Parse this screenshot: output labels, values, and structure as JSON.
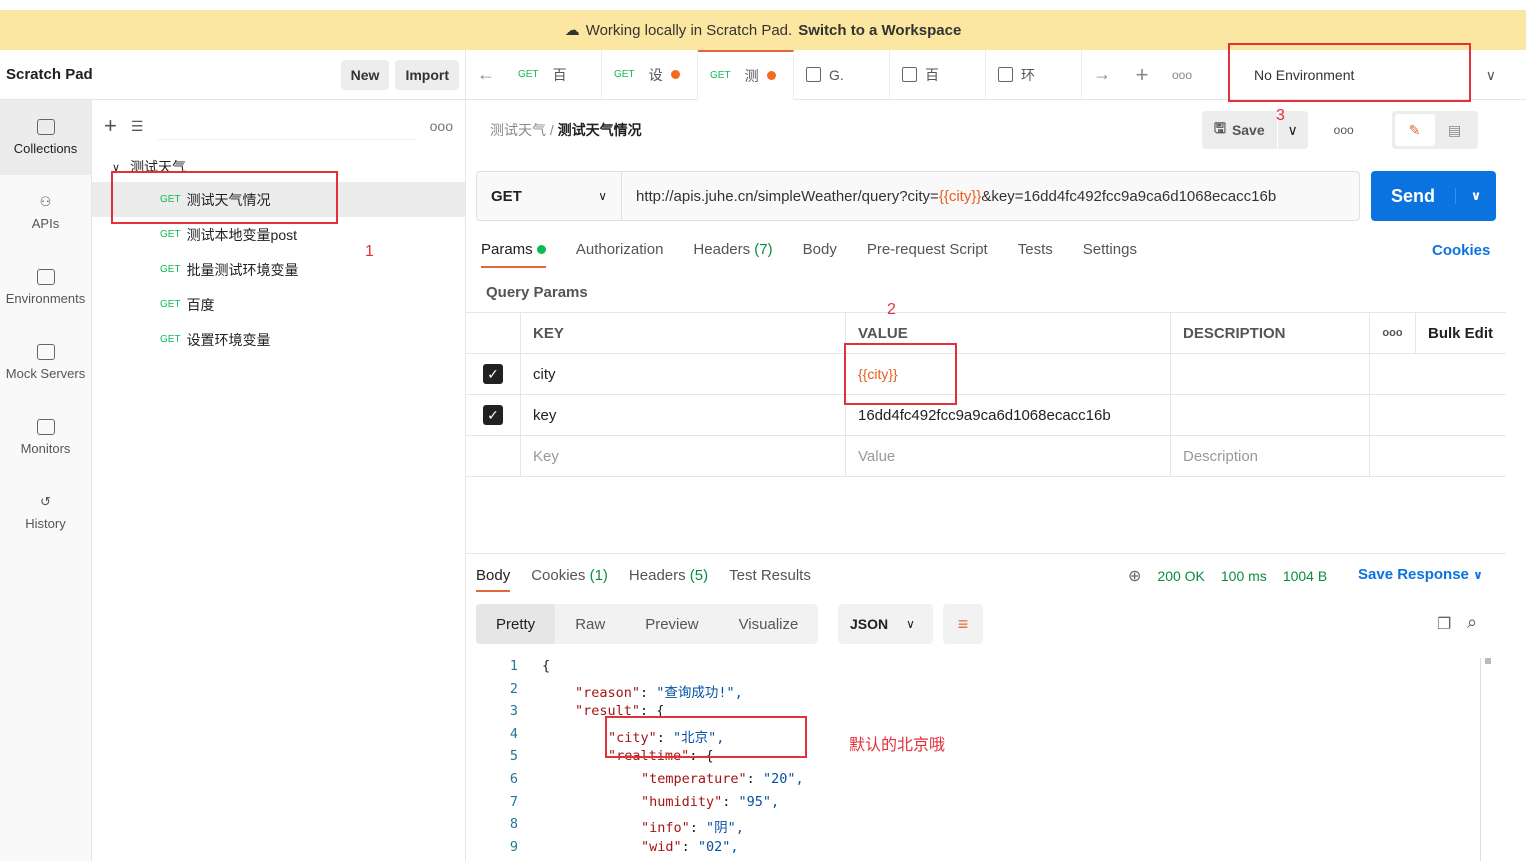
{
  "banner": {
    "text": "Working locally in Scratch Pad.",
    "link": "Switch to a Workspace"
  },
  "sidebar": {
    "title": "Scratch Pad",
    "new_label": "New",
    "import_label": "Import",
    "rail": [
      {
        "label": "Collections",
        "icon": "collections-icon"
      },
      {
        "label": "APIs",
        "icon": "apis-icon"
      },
      {
        "label": "Environments",
        "icon": "environments-icon"
      },
      {
        "label": "Mock Servers",
        "icon": "mock-servers-icon"
      },
      {
        "label": "Monitors",
        "icon": "monitors-icon"
      },
      {
        "label": "History",
        "icon": "history-icon"
      }
    ],
    "collection": "测试天气",
    "items": [
      {
        "method": "GET",
        "name": "测试天气情况"
      },
      {
        "method": "GET",
        "name": "测试本地变量post"
      },
      {
        "method": "GET",
        "name": "批量测试环境变量"
      },
      {
        "method": "GET",
        "name": "百度"
      },
      {
        "method": "GET",
        "name": "设置环境变量"
      }
    ]
  },
  "tabs": [
    {
      "method": "GET",
      "name": "百"
    },
    {
      "method": "GET",
      "name": "设",
      "dirty": true
    },
    {
      "method": "GET",
      "name": "测",
      "dirty": true,
      "active": true
    },
    {
      "name": "G."
    },
    {
      "name": "百"
    },
    {
      "name": "环"
    }
  ],
  "environment": "No Environment",
  "breadcrumb": {
    "parent": "测试天气",
    "current": "测试天气情况"
  },
  "save_label": "Save",
  "request": {
    "method": "GET",
    "url_prefix": "http://apis.juhe.cn/simpleWeather/query?city=",
    "url_var": "{{city}}",
    "url_suffix": "&key=16dd4fc492fcc9a9ca6d1068ecacc16b",
    "send_label": "Send"
  },
  "req_tabs": {
    "params": "Params",
    "auth": "Authorization",
    "headers": "Headers",
    "headers_count": "(7)",
    "body": "Body",
    "prereq": "Pre-request Script",
    "tests": "Tests",
    "settings": "Settings",
    "cookies": "Cookies"
  },
  "query_params": {
    "title": "Query Params",
    "headers": [
      "KEY",
      "VALUE",
      "DESCRIPTION"
    ],
    "bulk_edit": "Bulk Edit",
    "rows": [
      {
        "key": "city",
        "value": "{{city}}",
        "checked": true
      },
      {
        "key": "key",
        "value": "16dd4fc492fcc9a9ca6d1068ecacc16b",
        "checked": true
      }
    ],
    "placeholders": {
      "key": "Key",
      "value": "Value",
      "description": "Description"
    }
  },
  "response": {
    "tabs": {
      "body": "Body",
      "cookies": "Cookies",
      "cookies_count": "(1)",
      "headers": "Headers",
      "headers_count": "(5)",
      "tests": "Test Results"
    },
    "status": "200 OK",
    "time": "100 ms",
    "size": "1004 B",
    "save": "Save Response",
    "formats": [
      "Pretty",
      "Raw",
      "Preview",
      "Visualize"
    ],
    "lang": "JSON"
  },
  "code_lines": [
    {
      "n": "1",
      "i": 0,
      "k": "",
      "v": "{"
    },
    {
      "n": "2",
      "i": 1,
      "k": "\"reason\"",
      "v": "\"查询成功!\","
    },
    {
      "n": "3",
      "i": 1,
      "k": "\"result\"",
      "v": "{"
    },
    {
      "n": "4",
      "i": 2,
      "k": "\"city\"",
      "v": "\"北京\","
    },
    {
      "n": "5",
      "i": 2,
      "k": "\"realtime\"",
      "v": "{"
    },
    {
      "n": "6",
      "i": 3,
      "k": "\"temperature\"",
      "v": "\"20\","
    },
    {
      "n": "7",
      "i": 3,
      "k": "\"humidity\"",
      "v": "\"95\","
    },
    {
      "n": "8",
      "i": 3,
      "k": "\"info\"",
      "v": "\"阴\","
    },
    {
      "n": "9",
      "i": 3,
      "k": "\"wid\"",
      "v": "\"02\","
    }
  ],
  "annotations": {
    "a1": "1",
    "a2": "2",
    "a3": "3",
    "note": "默认的北京哦"
  },
  "colors": {
    "accent": "#e0693b",
    "send": "#0b73e0",
    "get": "#0cbb52",
    "annotation": "#e3303a"
  }
}
